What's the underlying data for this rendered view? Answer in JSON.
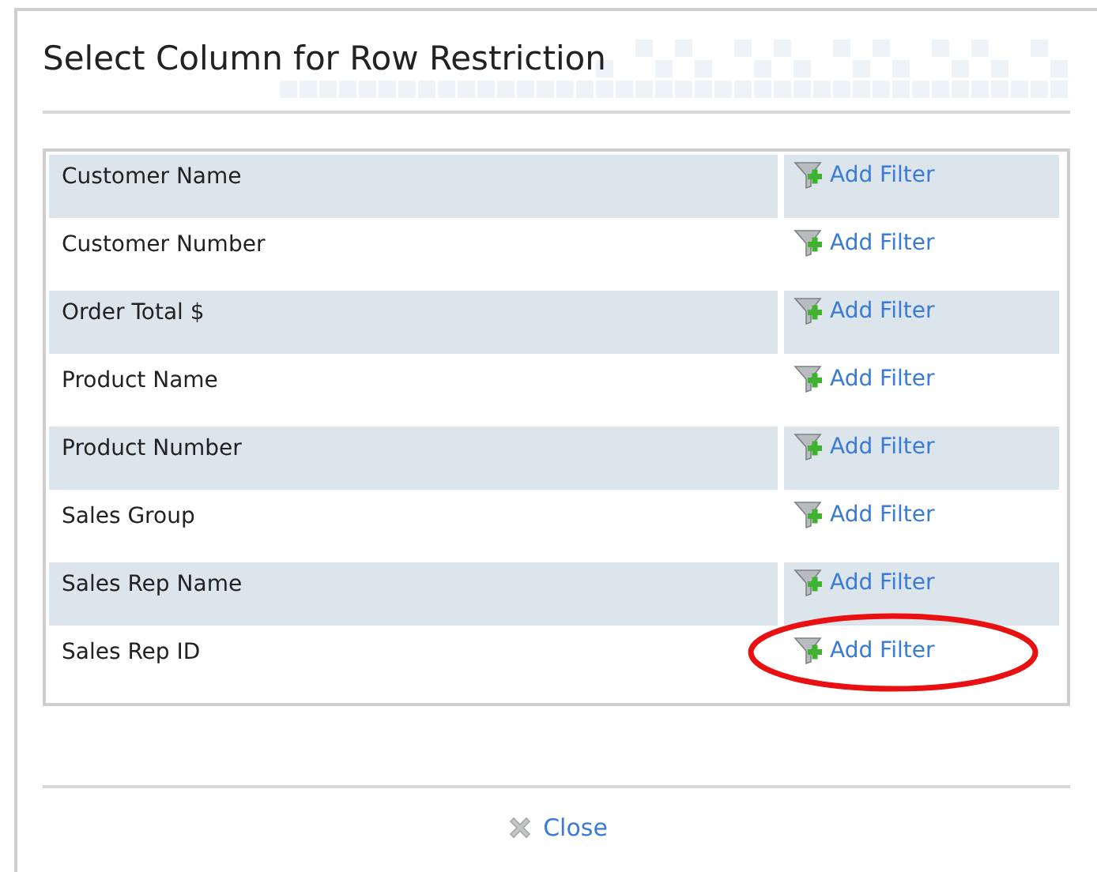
{
  "dialog": {
    "title": "Select Column for Row Restriction"
  },
  "rows": [
    {
      "column": "Customer Name",
      "action": "Add Filter",
      "highlighted": false
    },
    {
      "column": "Customer Number",
      "action": "Add Filter",
      "highlighted": false
    },
    {
      "column": "Order Total $",
      "action": "Add Filter",
      "highlighted": false
    },
    {
      "column": "Product Name",
      "action": "Add Filter",
      "highlighted": false
    },
    {
      "column": "Product Number",
      "action": "Add Filter",
      "highlighted": false
    },
    {
      "column": "Sales Group",
      "action": "Add Filter",
      "highlighted": false
    },
    {
      "column": "Sales Rep Name",
      "action": "Add Filter",
      "highlighted": false
    },
    {
      "column": "Sales Rep ID",
      "action": "Add Filter",
      "highlighted": true
    }
  ],
  "footer": {
    "close": "Close"
  }
}
